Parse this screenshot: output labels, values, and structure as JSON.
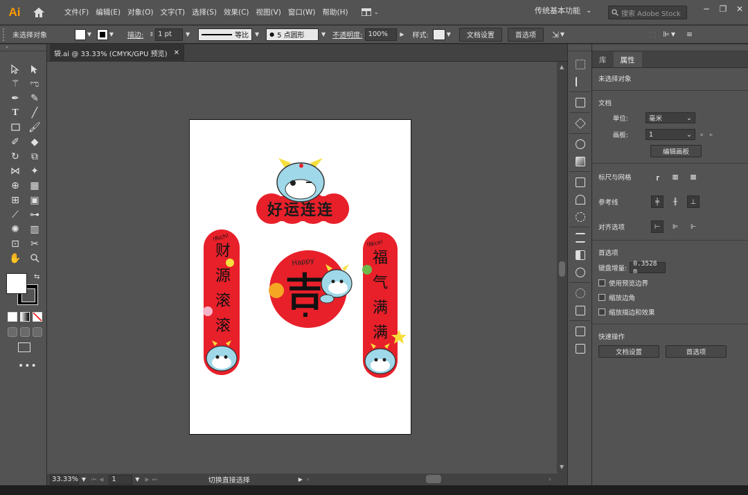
{
  "app": {
    "logo": "Ai",
    "workspace": "传统基本功能",
    "search_placeholder": "搜索 Adobe Stock"
  },
  "menu": [
    "文件(F)",
    "编辑(E)",
    "对象(O)",
    "文字(T)",
    "选择(S)",
    "效果(C)",
    "视图(V)",
    "窗口(W)",
    "帮助(H)"
  ],
  "control_bar": {
    "selection": "未选择对象",
    "stroke_label": "描边:",
    "stroke_weight": "1 pt",
    "stroke_profile": "等比",
    "brush": "5 点圆形",
    "opacity_label": "不透明度:",
    "opacity": "100%",
    "style_label": "样式:",
    "doc_setup": "文档设置",
    "preferences": "首选项"
  },
  "document": {
    "tab_title": "袋.ai @ 33.33% (CMYK/GPU 预览)"
  },
  "status_bar": {
    "zoom": "33.33%",
    "page": "1",
    "status": "切换直接选择"
  },
  "artwork": {
    "banner": "好运连连",
    "left_scroll": "财源滚滚",
    "left_tag": "!Rich!",
    "right_scroll": "福气满满",
    "right_tag": "!Nice!",
    "center_char": "吉",
    "center_tag": "Happy"
  },
  "properties": {
    "tabs": [
      "库",
      "属性"
    ],
    "no_selection": "未选择对象",
    "document_section": "文档",
    "unit_label": "单位:",
    "unit_value": "毫米",
    "artboard_label": "画板:",
    "artboard_value": "1",
    "edit_artboards": "编辑画板",
    "rulers_grid": "标尺与网格",
    "guides": "参考线",
    "align_options": "对齐选项",
    "preferences_section": "首选项",
    "keyboard_increment_label": "键盘增量:",
    "keyboard_increment_value": "0.3528 m",
    "checkboxes": [
      "使用预览边界",
      "缩放边角",
      "缩放描边和效果"
    ],
    "quick_actions": "快速操作",
    "qa_doc_setup": "文档设置",
    "qa_preferences": "首选项"
  },
  "colors": {
    "panel": "#535353",
    "canvas": "#535353",
    "dark": "#323232",
    "accent_logo": "#ff9a00",
    "festive_red": "#e8202a"
  }
}
